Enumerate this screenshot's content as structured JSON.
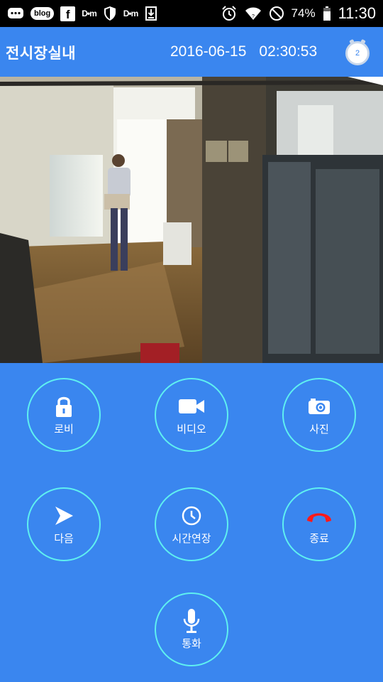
{
  "statusbar": {
    "left_icons": [
      "chat-icon",
      "blog-icon",
      "facebook-icon",
      "daum-icon",
      "shield-icon",
      "daum-icon",
      "download-icon"
    ],
    "blog_label": "blog",
    "facebook_label": "f",
    "daum_label": "D•m",
    "battery": "74%",
    "time": "11:30"
  },
  "header": {
    "title": "전시장실내",
    "date": "2016-06-15",
    "time": "02:30:53",
    "badge": "2"
  },
  "controls": {
    "lobby": {
      "label": "로비",
      "icon": "lock-icon"
    },
    "video": {
      "label": "비디오",
      "icon": "video-camera-icon"
    },
    "photo": {
      "label": "사진",
      "icon": "camera-icon"
    },
    "next": {
      "label": "다음",
      "icon": "arrow-right-icon"
    },
    "extend": {
      "label": "시간연장",
      "icon": "clock-icon"
    },
    "end": {
      "label": "종료",
      "icon": "hang-up-icon"
    },
    "talk": {
      "label": "통화",
      "icon": "microphone-icon"
    }
  },
  "colors": {
    "background": "#3a86ef",
    "ring": "#5ff0f0",
    "hangup": "#ff1a1a"
  }
}
